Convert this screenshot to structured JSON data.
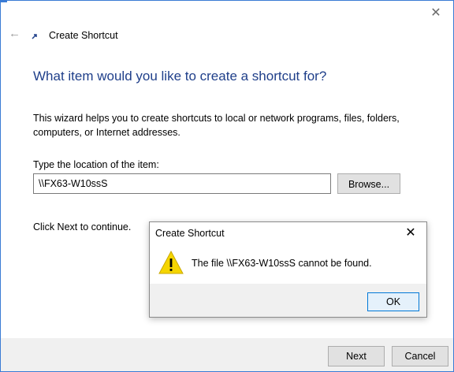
{
  "window": {
    "title": "Create Shortcut",
    "close_glyph": "✕",
    "back_glyph": "←"
  },
  "wizard": {
    "heading": "What item would you like to create a shortcut for?",
    "description": "This wizard helps you to create shortcuts to local or network programs, files, folders, computers, or Internet addresses.",
    "location_label": "Type the location of the item:",
    "location_value": "\\\\FX63-W10ssS",
    "browse_label": "Browse...",
    "continue_text": "Click Next to continue.",
    "next_label": "Next",
    "cancel_label": "Cancel"
  },
  "dialog": {
    "title": "Create Shortcut",
    "close_glyph": "✕",
    "message": "The file \\\\FX63-W10ssS cannot be found.",
    "ok_label": "OK"
  },
  "colors": {
    "heading": "#1f3f8a",
    "warning_fill": "#f5d500",
    "accent": "#0078d7"
  },
  "icons": {
    "back": "back-arrow-icon",
    "shortcut": "shortcut-wizard-icon",
    "close": "close-icon",
    "warning": "warning-icon"
  }
}
